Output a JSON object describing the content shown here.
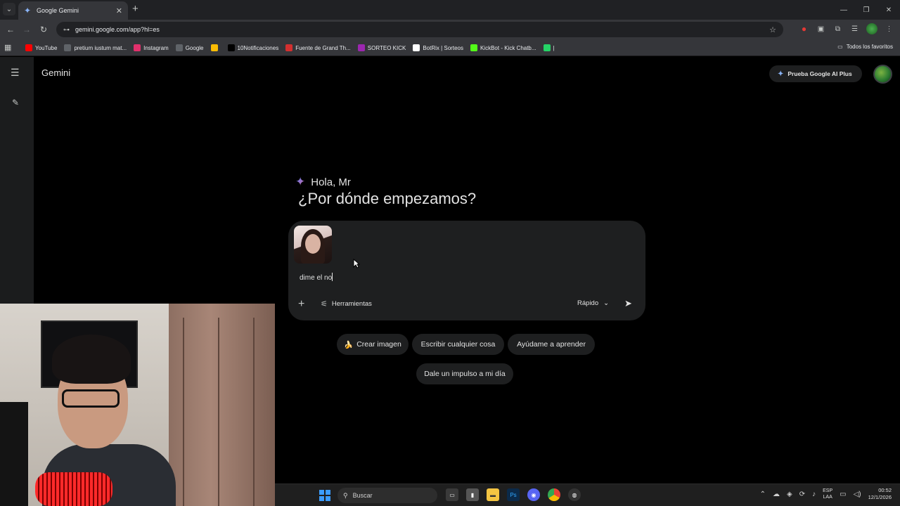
{
  "browser": {
    "tab_title": "Google Gemini",
    "url": "gemini.google.com/app?hl=es",
    "bookmarks": [
      {
        "label": "YouTube",
        "color": "#ff0000"
      },
      {
        "label": "pretium iustum mat...",
        "color": "#5f6368"
      },
      {
        "label": "Instagram",
        "color": "#e1306c"
      },
      {
        "label": "Google",
        "color": "#5f6368"
      },
      {
        "label": "",
        "color": "#fbbc04"
      },
      {
        "label": "10Notificaciones",
        "color": "#000000"
      },
      {
        "label": "Fuente de Grand Th...",
        "color": "#d32f2f"
      },
      {
        "label": "SORTEO KICK",
        "color": "#9c27b0"
      },
      {
        "label": "BotRix | Sorteos",
        "color": "#ffffff"
      },
      {
        "label": "KickBot - Kick Chatb...",
        "color": "#53fc18"
      },
      {
        "label": "|",
        "color": "#25d366"
      }
    ],
    "all_bookmarks_label": "Todos los favoritos"
  },
  "app": {
    "title": "Gemini",
    "upgrade_label": "Prueba Google AI Plus",
    "greeting": "Hola, Mr",
    "headline": "¿Por dónde empezamos?",
    "prompt_value": "dime el no",
    "tools_label": "Herramientas",
    "model_label": "Rápido",
    "chips": [
      {
        "label": "Crear imagen",
        "emoji": "🍌"
      },
      {
        "label": "Escribir cualquier cosa",
        "emoji": ""
      },
      {
        "label": "Ayúdame a aprender",
        "emoji": ""
      },
      {
        "label": "Dale un impulso a mi día",
        "emoji": ""
      }
    ]
  },
  "taskbar": {
    "search_label": "Buscar",
    "lang_top": "ESP",
    "lang_bottom": "LAA",
    "time": "00:52",
    "date": "12/1/2026"
  }
}
